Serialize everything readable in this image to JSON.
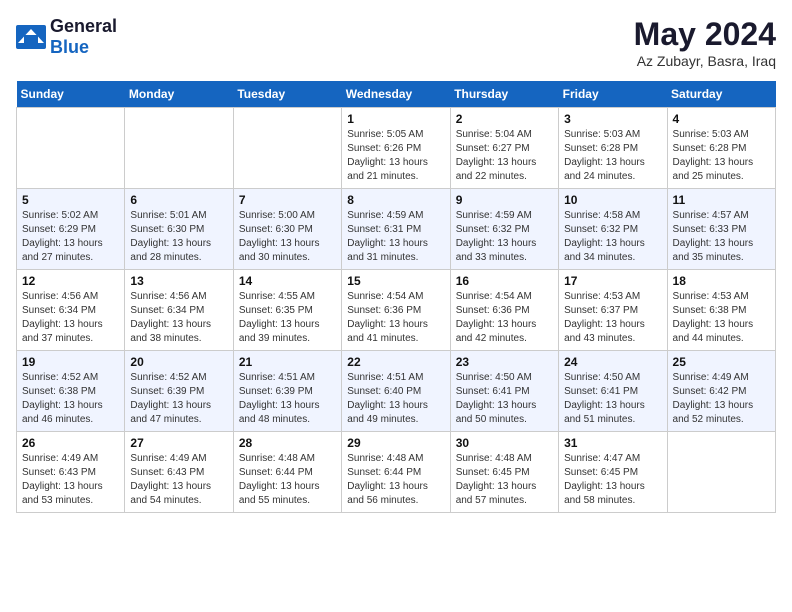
{
  "header": {
    "logo_general": "General",
    "logo_blue": "Blue",
    "title": "May 2024",
    "subtitle": "Az Zubayr, Basra, Iraq"
  },
  "days_of_week": [
    "Sunday",
    "Monday",
    "Tuesday",
    "Wednesday",
    "Thursday",
    "Friday",
    "Saturday"
  ],
  "weeks": [
    [
      {
        "day": "",
        "info": ""
      },
      {
        "day": "",
        "info": ""
      },
      {
        "day": "",
        "info": ""
      },
      {
        "day": "1",
        "info": "Sunrise: 5:05 AM\nSunset: 6:26 PM\nDaylight: 13 hours\nand 21 minutes."
      },
      {
        "day": "2",
        "info": "Sunrise: 5:04 AM\nSunset: 6:27 PM\nDaylight: 13 hours\nand 22 minutes."
      },
      {
        "day": "3",
        "info": "Sunrise: 5:03 AM\nSunset: 6:28 PM\nDaylight: 13 hours\nand 24 minutes."
      },
      {
        "day": "4",
        "info": "Sunrise: 5:03 AM\nSunset: 6:28 PM\nDaylight: 13 hours\nand 25 minutes."
      }
    ],
    [
      {
        "day": "5",
        "info": "Sunrise: 5:02 AM\nSunset: 6:29 PM\nDaylight: 13 hours\nand 27 minutes."
      },
      {
        "day": "6",
        "info": "Sunrise: 5:01 AM\nSunset: 6:30 PM\nDaylight: 13 hours\nand 28 minutes."
      },
      {
        "day": "7",
        "info": "Sunrise: 5:00 AM\nSunset: 6:30 PM\nDaylight: 13 hours\nand 30 minutes."
      },
      {
        "day": "8",
        "info": "Sunrise: 4:59 AM\nSunset: 6:31 PM\nDaylight: 13 hours\nand 31 minutes."
      },
      {
        "day": "9",
        "info": "Sunrise: 4:59 AM\nSunset: 6:32 PM\nDaylight: 13 hours\nand 33 minutes."
      },
      {
        "day": "10",
        "info": "Sunrise: 4:58 AM\nSunset: 6:32 PM\nDaylight: 13 hours\nand 34 minutes."
      },
      {
        "day": "11",
        "info": "Sunrise: 4:57 AM\nSunset: 6:33 PM\nDaylight: 13 hours\nand 35 minutes."
      }
    ],
    [
      {
        "day": "12",
        "info": "Sunrise: 4:56 AM\nSunset: 6:34 PM\nDaylight: 13 hours\nand 37 minutes."
      },
      {
        "day": "13",
        "info": "Sunrise: 4:56 AM\nSunset: 6:34 PM\nDaylight: 13 hours\nand 38 minutes."
      },
      {
        "day": "14",
        "info": "Sunrise: 4:55 AM\nSunset: 6:35 PM\nDaylight: 13 hours\nand 39 minutes."
      },
      {
        "day": "15",
        "info": "Sunrise: 4:54 AM\nSunset: 6:36 PM\nDaylight: 13 hours\nand 41 minutes."
      },
      {
        "day": "16",
        "info": "Sunrise: 4:54 AM\nSunset: 6:36 PM\nDaylight: 13 hours\nand 42 minutes."
      },
      {
        "day": "17",
        "info": "Sunrise: 4:53 AM\nSunset: 6:37 PM\nDaylight: 13 hours\nand 43 minutes."
      },
      {
        "day": "18",
        "info": "Sunrise: 4:53 AM\nSunset: 6:38 PM\nDaylight: 13 hours\nand 44 minutes."
      }
    ],
    [
      {
        "day": "19",
        "info": "Sunrise: 4:52 AM\nSunset: 6:38 PM\nDaylight: 13 hours\nand 46 minutes."
      },
      {
        "day": "20",
        "info": "Sunrise: 4:52 AM\nSunset: 6:39 PM\nDaylight: 13 hours\nand 47 minutes."
      },
      {
        "day": "21",
        "info": "Sunrise: 4:51 AM\nSunset: 6:39 PM\nDaylight: 13 hours\nand 48 minutes."
      },
      {
        "day": "22",
        "info": "Sunrise: 4:51 AM\nSunset: 6:40 PM\nDaylight: 13 hours\nand 49 minutes."
      },
      {
        "day": "23",
        "info": "Sunrise: 4:50 AM\nSunset: 6:41 PM\nDaylight: 13 hours\nand 50 minutes."
      },
      {
        "day": "24",
        "info": "Sunrise: 4:50 AM\nSunset: 6:41 PM\nDaylight: 13 hours\nand 51 minutes."
      },
      {
        "day": "25",
        "info": "Sunrise: 4:49 AM\nSunset: 6:42 PM\nDaylight: 13 hours\nand 52 minutes."
      }
    ],
    [
      {
        "day": "26",
        "info": "Sunrise: 4:49 AM\nSunset: 6:43 PM\nDaylight: 13 hours\nand 53 minutes."
      },
      {
        "day": "27",
        "info": "Sunrise: 4:49 AM\nSunset: 6:43 PM\nDaylight: 13 hours\nand 54 minutes."
      },
      {
        "day": "28",
        "info": "Sunrise: 4:48 AM\nSunset: 6:44 PM\nDaylight: 13 hours\nand 55 minutes."
      },
      {
        "day": "29",
        "info": "Sunrise: 4:48 AM\nSunset: 6:44 PM\nDaylight: 13 hours\nand 56 minutes."
      },
      {
        "day": "30",
        "info": "Sunrise: 4:48 AM\nSunset: 6:45 PM\nDaylight: 13 hours\nand 57 minutes."
      },
      {
        "day": "31",
        "info": "Sunrise: 4:47 AM\nSunset: 6:45 PM\nDaylight: 13 hours\nand 58 minutes."
      },
      {
        "day": "",
        "info": ""
      }
    ]
  ]
}
